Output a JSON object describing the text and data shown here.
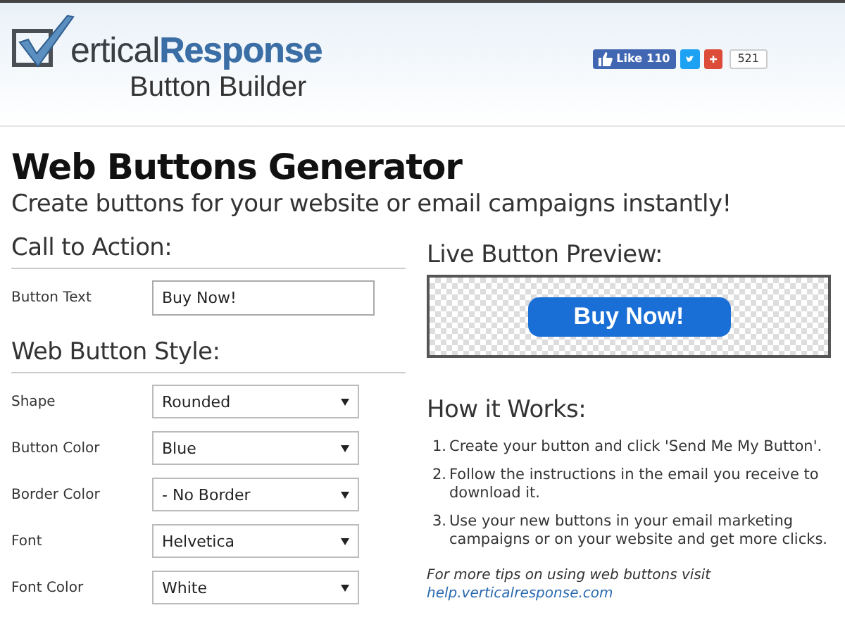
{
  "header": {
    "logo_dark": "ertical",
    "logo_blue": "Response",
    "logo_sub": "Button Builder",
    "like": {
      "label": "Like",
      "count": "110"
    },
    "share_count": "521"
  },
  "title": "Web Buttons Generator",
  "subtitle": "Create buttons for your website or email campaigns instantly!",
  "call_to_action": {
    "heading": "Call to Action:",
    "label": "Button Text",
    "value": "Buy Now!"
  },
  "style": {
    "heading": "Web Button Style:",
    "fields": [
      {
        "label": "Shape",
        "value": "Rounded"
      },
      {
        "label": "Button Color",
        "value": "Blue"
      },
      {
        "label": "Border Color",
        "value": "- No Border"
      },
      {
        "label": "Font",
        "value": "Helvetica"
      },
      {
        "label": "Font Color",
        "value": "White"
      }
    ]
  },
  "preview": {
    "heading": "Live Button Preview:",
    "button": "Buy Now!"
  },
  "how": {
    "heading": "How it Works:",
    "steps": [
      {
        "number": "1.",
        "text": "Create your button and click 'Send Me My Button'."
      },
      {
        "number": "2.",
        "text": "Follow the instructions in the email you receive to download it."
      },
      {
        "number": "3.",
        "text": "Use your new buttons in your email marketing campaigns or on your website and get more clicks."
      }
    ],
    "tip": "For more tips on using web buttons visit",
    "link": "help.verticalresponse.com"
  }
}
